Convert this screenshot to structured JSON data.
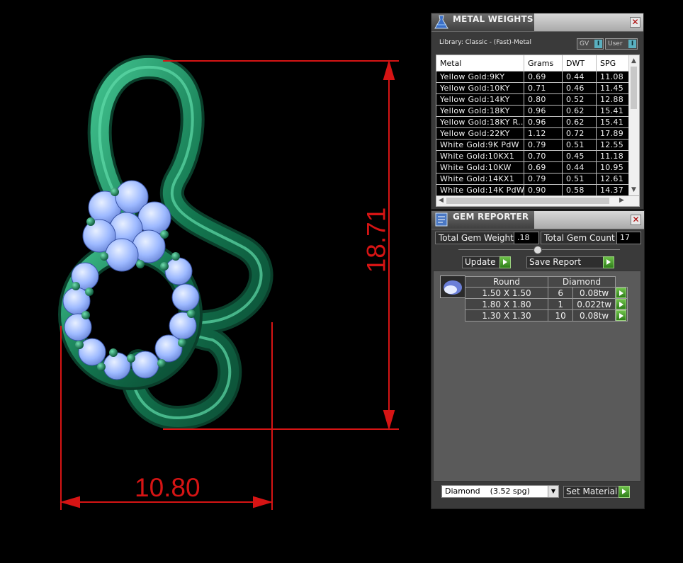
{
  "viewport": {
    "dim_width": "10.80",
    "dim_height": "18.71",
    "dim_color": "#d61414",
    "metal_color": "#1f8a63",
    "gem_color": "#a8c4ff"
  },
  "metal_weights": {
    "title": "METAL WEIGHTS",
    "library": "Library: Classic - (Fast)-Metal",
    "gv_label": "GV",
    "user_label": "User",
    "columns": [
      "Metal",
      "Grams",
      "DWT",
      "SPG"
    ],
    "rows": [
      [
        "Yellow Gold:9KY",
        "0.69",
        "0.44",
        "11.08"
      ],
      [
        "Yellow Gold:10KY",
        "0.71",
        "0.46",
        "11.45"
      ],
      [
        "Yellow Gold:14KY",
        "0.80",
        "0.52",
        "12.88"
      ],
      [
        "Yellow Gold:18KY",
        "0.96",
        "0.62",
        "15.41"
      ],
      [
        "Yellow Gold:18KY R...",
        "0.96",
        "0.62",
        "15.41"
      ],
      [
        "Yellow Gold:22KY",
        "1.12",
        "0.72",
        "17.89"
      ],
      [
        "White Gold:9K PdW",
        "0.79",
        "0.51",
        "12.55"
      ],
      [
        "White Gold:10KX1",
        "0.70",
        "0.45",
        "11.18"
      ],
      [
        "White Gold:10KW",
        "0.69",
        "0.44",
        "10.95"
      ],
      [
        "White Gold:14KX1",
        "0.79",
        "0.51",
        "12.61"
      ],
      [
        "White Gold:14K PdW",
        "0.90",
        "0.58",
        "14.37"
      ]
    ]
  },
  "gem_reporter": {
    "title": "GEM REPORTER",
    "total_weight_label": "Total Gem Weight",
    "total_weight_value": ".18",
    "total_count_label": "Total Gem Count",
    "total_count_value": "17",
    "update_label": "Update",
    "save_label": "Save Report",
    "table_header": [
      "Round",
      "Diamond"
    ],
    "gems": [
      [
        "1.50 X 1.50",
        "6",
        "0.08tw"
      ],
      [
        "1.80 X 1.80",
        "1",
        "0.022tw"
      ],
      [
        "1.30 X 1.30",
        "10",
        "0.08tw"
      ]
    ],
    "material_select": "Diamond    (3.52 spg)",
    "set_material_label": "Set Material"
  }
}
